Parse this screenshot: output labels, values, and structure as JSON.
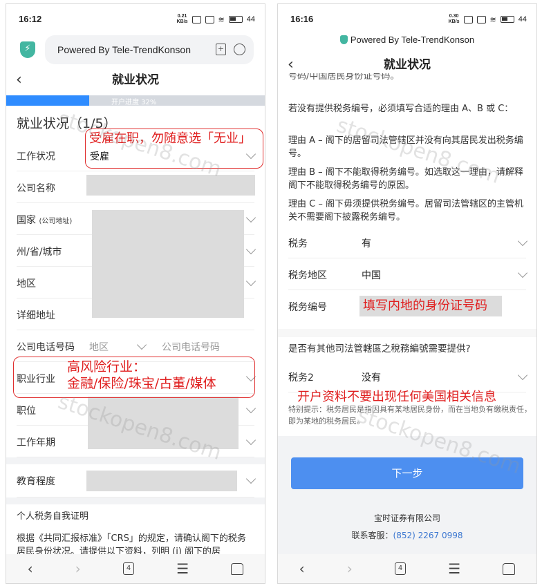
{
  "left": {
    "status": {
      "time": "16:12",
      "speed_top": "0.21",
      "speed_unit": "KB/s",
      "battery": "44"
    },
    "browser": {
      "url_text": "Powered By Tele-TrendKonson"
    },
    "header": {
      "back": "‹",
      "title": "就业状况"
    },
    "progress": {
      "label": "开户进度 32%",
      "value": 0.32
    },
    "section_title": "就业状况（1/5）",
    "fields": {
      "work_status": {
        "label": "工作状况",
        "value": "受雇"
      },
      "company_name": {
        "label": "公司名称"
      },
      "country": {
        "label": "国家",
        "label_small": "(公司地址)"
      },
      "state": {
        "label": "州/省/城市"
      },
      "district": {
        "label": "地区"
      },
      "address": {
        "label": "详细地址"
      },
      "phone": {
        "label": "公司电话号码",
        "area_placeholder": "地区",
        "phone_placeholder": "公司电话号码"
      },
      "industry": {
        "label": "职业行业"
      },
      "position": {
        "label": "职位"
      },
      "years": {
        "label": "工作年期"
      },
      "education": {
        "label": "教育程度"
      }
    },
    "annotations": {
      "work": "受雇在职，勿随意选「无业」",
      "industry_line1": "高风险行业：",
      "industry_line2": "金融/保险/珠宝/古董/媒体"
    },
    "tax_section": {
      "title": "个人税务自我证明",
      "para": "根据《共同汇报标准》「CRS」的规定，请确认阁下的税务居民身份状况。请提供以下资料，列明 (i) 阁下的居"
    },
    "watermark": "stockopen8.com",
    "nav": {
      "back": "‹",
      "forward": "›",
      "tabs": "4",
      "menu": "☰"
    }
  },
  "right": {
    "status": {
      "time": "16:16",
      "speed_top": "0.30",
      "speed_unit": "KB/s",
      "battery": "44"
    },
    "browser": {
      "url_text": "Powered By Tele-TrendKonson"
    },
    "header": {
      "back": "‹",
      "title": "就业状况"
    },
    "cut_text": "号码/中国居民身份证号码。",
    "reasons": {
      "intro": "若没有提供税务编号，必须填写合适的理由 A、B 或 C：",
      "a": "理由 A – 阁下的居留司法管辖区并没有向其居民发出税务编号。",
      "b": "理由 B – 阁下不能取得税务编号。如选取这一理由，请解释阁下不能取得税务编号的原因。",
      "c": "理由 C – 阁下毋须提供税务编号。居留司法管辖区的主管机关不需要阁下披露税务编号。"
    },
    "tax": {
      "label": "税务",
      "value": "有"
    },
    "tax_region": {
      "label": "税务地区",
      "value": "中国"
    },
    "tax_number": {
      "label": "税务编号",
      "annotation": "填写内地的身份证号码"
    },
    "other_question": "是否有其他司法管轄區之稅務編號需要提供?",
    "tax2": {
      "label": "税务2",
      "value": "没有"
    },
    "us_annotation": "开户资料不要出现任何美国相关信息",
    "tip": "特别提示：税务居民是指因具有某地居民身份，而在当地负有缴税责任，即为某地的税务居民。",
    "next_button": "下一步",
    "company": "宝时证券有限公司",
    "service_label": "联系客服：",
    "service_phone": "(852) 2267 0998",
    "watermark": "stockopen8.com",
    "nav": {
      "back": "‹",
      "forward": "›",
      "tabs": "4",
      "menu": "☰"
    }
  }
}
